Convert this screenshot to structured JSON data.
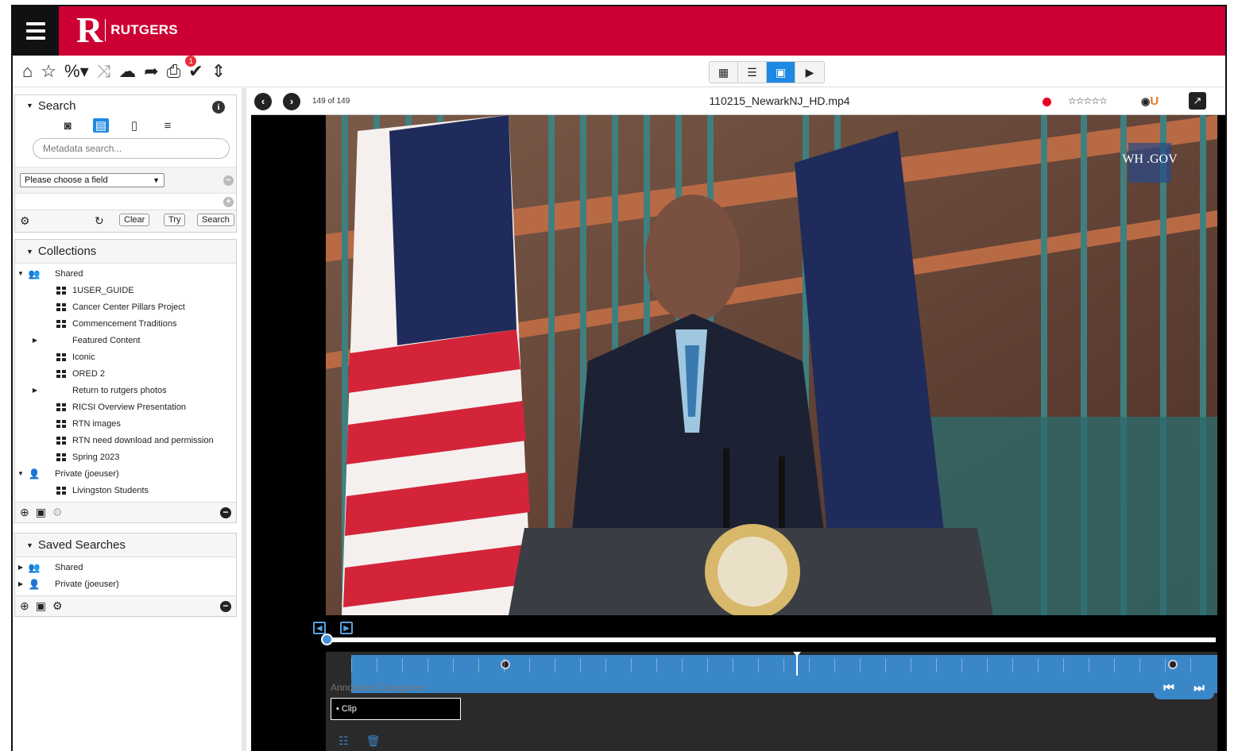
{
  "app": {
    "brand": "RUTGERS",
    "logo_letter": "R",
    "brand_color": "#cc0033"
  },
  "toolbar": {
    "icons": [
      "home-icon",
      "star-icon",
      "link-icon",
      "shuffle-icon",
      "cloud-download-icon",
      "share-icon",
      "print-icon",
      "check-icon",
      "sort-icon"
    ],
    "badge_count": "1",
    "views": [
      "grid-view",
      "list-view",
      "image-view",
      "video-view"
    ],
    "active_view": "image-view"
  },
  "search": {
    "title": "Search",
    "placeholder": "Metadata search...",
    "field_select": "Please choose a field",
    "clear_label": "Clear",
    "try_label": "Try",
    "search_label": "Search"
  },
  "collections": {
    "title": "Collections",
    "shared_label": "Shared",
    "shared_items": [
      "1USER_GUIDE",
      "Cancer Center Pillars Project",
      "Commencement Traditions",
      "Featured Content",
      "Iconic",
      "ORED 2",
      "Return to rutgers photos",
      "RICSI Overview Presentation",
      "RTN images",
      "RTN need download and permission",
      "Spring 2023"
    ],
    "private_label": "Private (joeuser)",
    "private_items": [
      "Livingston Students"
    ]
  },
  "saved_searches": {
    "title": "Saved Searches",
    "shared_label": "Shared",
    "private_label": "Private (joeuser)"
  },
  "viewer": {
    "count": "149 of 149",
    "filename": "110215_NewarkNJ_HD.mp4",
    "stars": "☆☆☆☆☆",
    "eye_letter": "U",
    "watermark": "WH .GOV"
  },
  "timeline": {
    "annotation_label": "Annotation Categories",
    "clip_label": "• Clip",
    "progress": 0.0
  }
}
